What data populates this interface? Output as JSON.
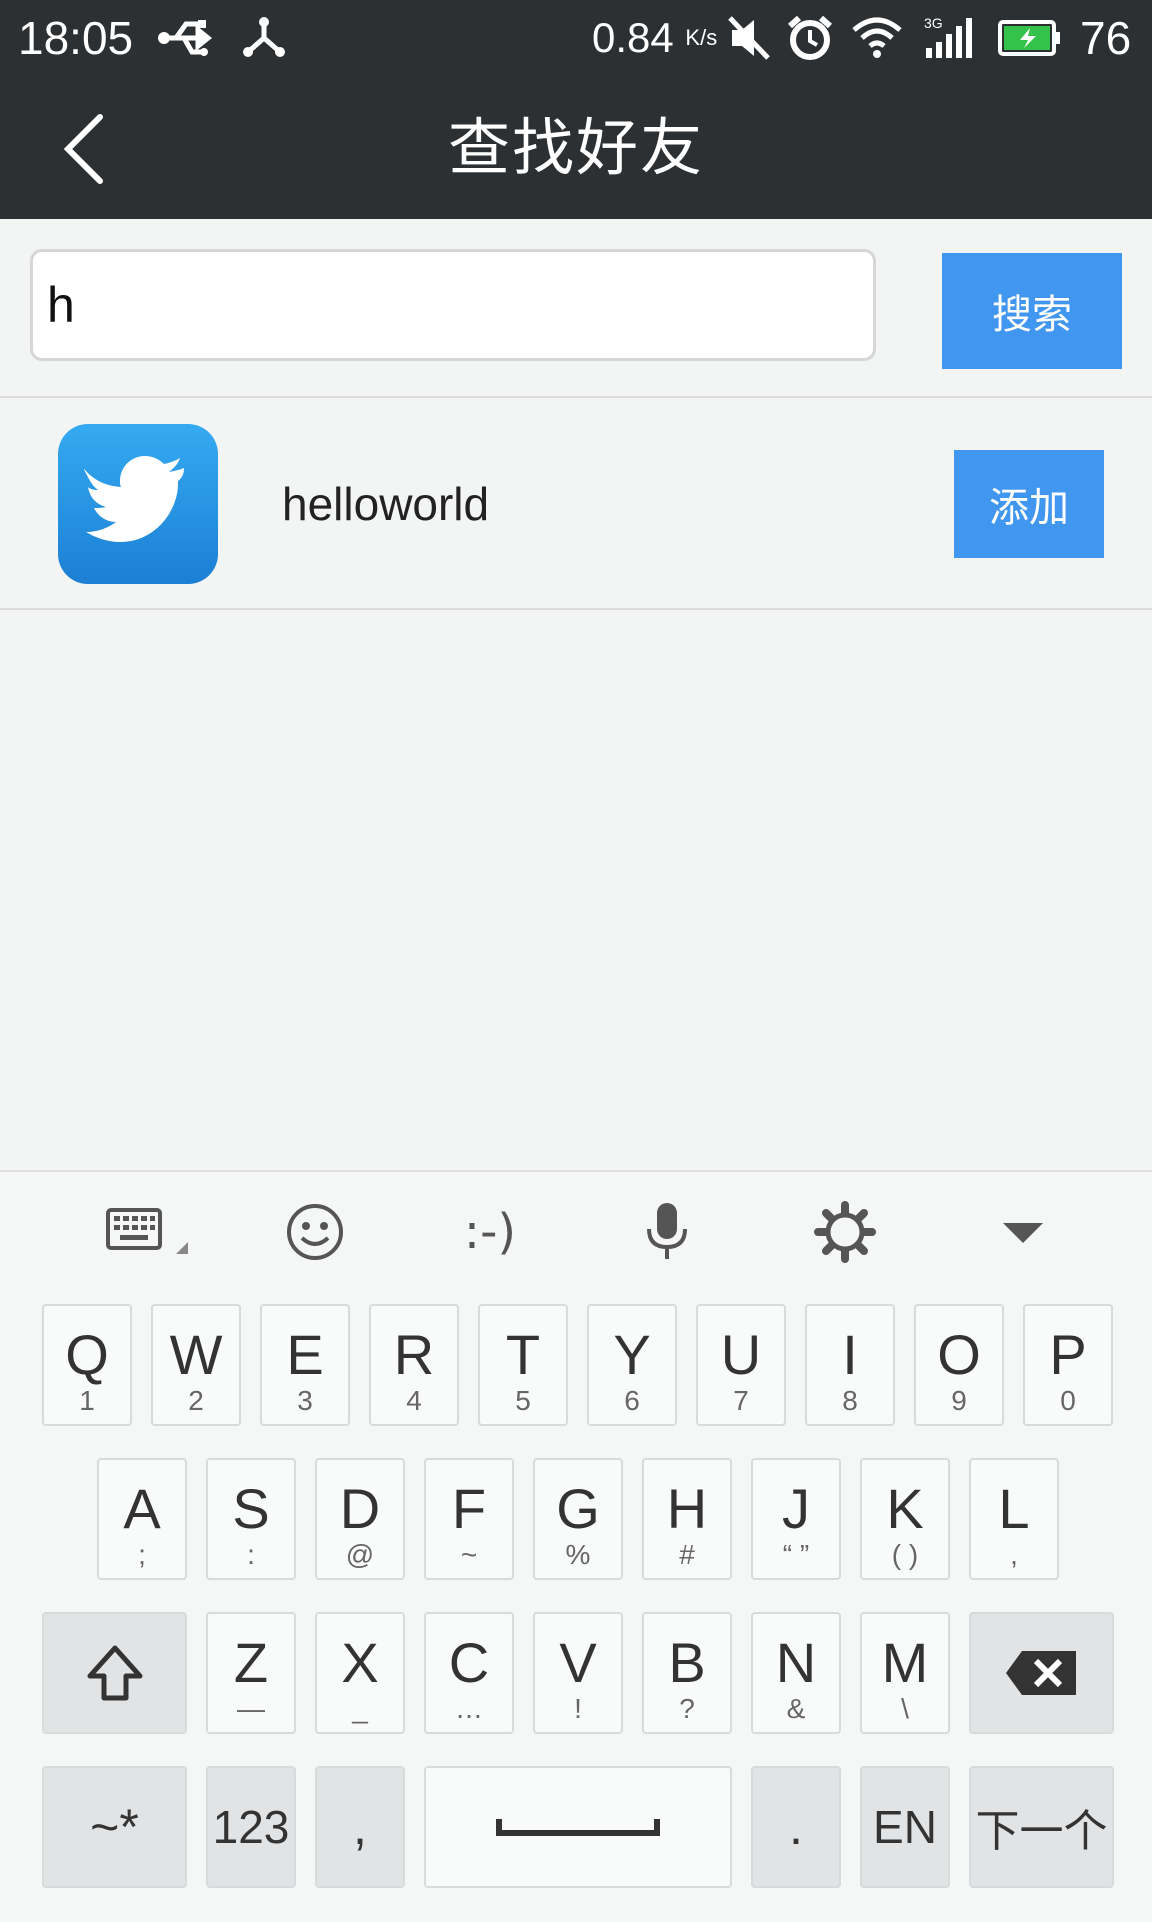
{
  "status_bar": {
    "time": "18:05",
    "speed_value": "0.84",
    "speed_unit": "K/s",
    "network": "3G",
    "battery_percent": "76",
    "icons": [
      "usb-icon",
      "share-icon",
      "mute-icon",
      "alarm-icon",
      "wifi-icon",
      "signal-icon",
      "battery-icon"
    ]
  },
  "header": {
    "title": "查找好友",
    "back_icon": "back-arrow-icon"
  },
  "search": {
    "value": "h",
    "button_label": "搜索"
  },
  "results": [
    {
      "username": "helloworld",
      "avatar_icon": "twitter-bird-icon",
      "add_label": "添加"
    }
  ],
  "keyboard": {
    "toolbar": [
      "keyboard-icon",
      "emoji-icon",
      "emoticon-icon",
      "microphone-icon",
      "settings-icon",
      "collapse-icon"
    ],
    "emoticon_text": ":-)",
    "row1": [
      {
        "main": "Q",
        "sub": "1"
      },
      {
        "main": "W",
        "sub": "2"
      },
      {
        "main": "E",
        "sub": "3"
      },
      {
        "main": "R",
        "sub": "4"
      },
      {
        "main": "T",
        "sub": "5"
      },
      {
        "main": "Y",
        "sub": "6"
      },
      {
        "main": "U",
        "sub": "7"
      },
      {
        "main": "I",
        "sub": "8"
      },
      {
        "main": "O",
        "sub": "9"
      },
      {
        "main": "P",
        "sub": "0"
      }
    ],
    "row2": [
      {
        "main": "A",
        "sub": ";"
      },
      {
        "main": "S",
        "sub": ":"
      },
      {
        "main": "D",
        "sub": "@"
      },
      {
        "main": "F",
        "sub": "~"
      },
      {
        "main": "G",
        "sub": "%"
      },
      {
        "main": "H",
        "sub": "#"
      },
      {
        "main": "J",
        "sub": "“ ”"
      },
      {
        "main": "K",
        "sub": "( )"
      },
      {
        "main": "L",
        "sub": ","
      }
    ],
    "row3": [
      {
        "main": "Z",
        "sub": "—"
      },
      {
        "main": "X",
        "sub": "_"
      },
      {
        "main": "C",
        "sub": "…"
      },
      {
        "main": "V",
        "sub": "!"
      },
      {
        "main": "B",
        "sub": "?"
      },
      {
        "main": "N",
        "sub": "&"
      },
      {
        "main": "M",
        "sub": "\\"
      }
    ],
    "symbols_label": "~*",
    "numbers_label": "123",
    "comma_label": ",",
    "period_label": ".",
    "lang_label": "EN",
    "next_label": "下一个",
    "accent_color": "#4196ef"
  }
}
